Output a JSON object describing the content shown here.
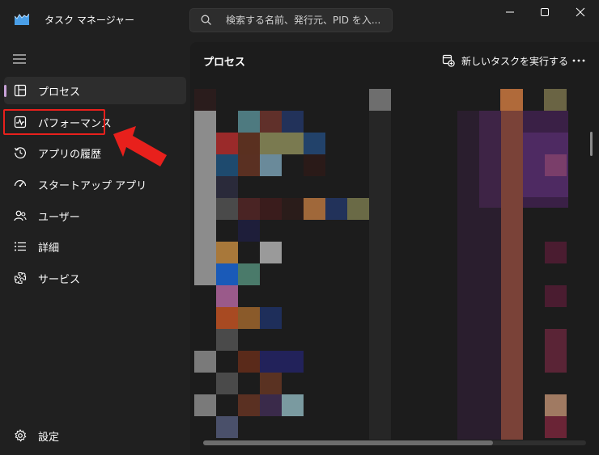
{
  "window": {
    "title": "タスク マネージャー",
    "icon": "task-manager-icon"
  },
  "search": {
    "placeholder": "検索する名前、発行元、PID を入...",
    "icon": "search-icon"
  },
  "window_controls": [
    "minimize-icon",
    "maximize-icon",
    "close-icon"
  ],
  "sidebar": {
    "items": [
      {
        "label": "プロセス",
        "icon": "processes-icon",
        "active": true
      },
      {
        "label": "パフォーマンス",
        "icon": "performance-icon",
        "active": false,
        "highlighted": true
      },
      {
        "label": "アプリの履歴",
        "icon": "app-history-icon",
        "active": false
      },
      {
        "label": "スタートアップ アプリ",
        "icon": "startup-apps-icon",
        "active": false
      },
      {
        "label": "ユーザー",
        "icon": "users-icon",
        "active": false
      },
      {
        "label": "詳細",
        "icon": "details-icon",
        "active": false
      },
      {
        "label": "サービス",
        "icon": "services-icon",
        "active": false
      }
    ],
    "settings": {
      "label": "設定",
      "icon": "settings-icon"
    }
  },
  "main": {
    "title": "プロセス",
    "run_task": {
      "label": "新しいタスクを実行する",
      "icon": "run-task-icon"
    },
    "more_icon": "more-options-icon",
    "content_state": "pixelated (obscured process list)"
  },
  "colors": {
    "background": "#202020",
    "panel": "#1c1c1c",
    "accent": "#c8a2d8",
    "annotation_red": "#e8201c"
  }
}
